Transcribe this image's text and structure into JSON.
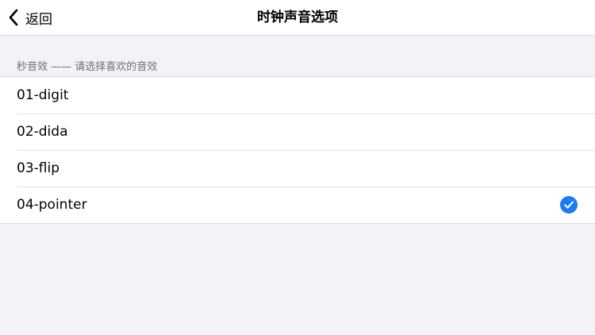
{
  "navbar": {
    "back_label": "返回",
    "title": "时钟声音选项"
  },
  "section": {
    "header": "秒音效 —— 请选择喜欢的音效"
  },
  "options": [
    {
      "label": "01-digit",
      "selected": false
    },
    {
      "label": "02-dida",
      "selected": false
    },
    {
      "label": "03-flip",
      "selected": false
    },
    {
      "label": "04-pointer",
      "selected": true
    }
  ],
  "colors": {
    "accent": "#1a7cf5",
    "background": "#f2f2f7",
    "section_text": "#6d6d72"
  },
  "icons": {
    "back": "chevron-left-icon",
    "selected": "checkmark-circle-icon"
  }
}
